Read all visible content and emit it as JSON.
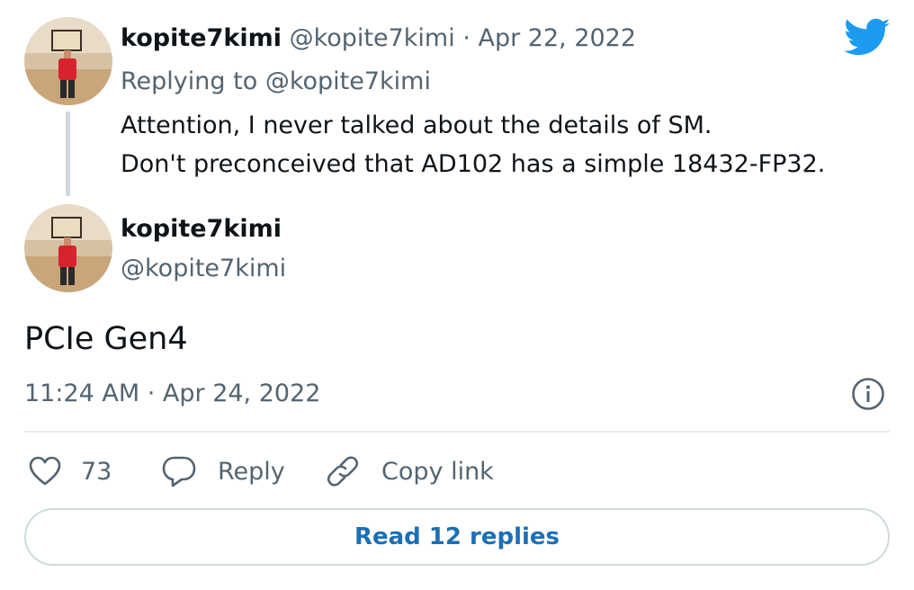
{
  "parent_tweet": {
    "display_name": "kopite7kimi",
    "handle": "@kopite7kimi",
    "separator": "·",
    "date": "Apr 22, 2022",
    "replying_prefix": "Replying to",
    "replying_handle": "@kopite7kimi",
    "text_lines": [
      "Attention, I never talked about the details of SM.",
      "Don't preconceived that AD102 has a simple 18432-FP32."
    ]
  },
  "tweet": {
    "display_name": "kopite7kimi",
    "handle": "@kopite7kimi",
    "text": "PCIe Gen4",
    "timestamp": "11:24 AM · Apr 24, 2022"
  },
  "actions": {
    "like_count": "73",
    "reply_label": "Reply",
    "copy_link_label": "Copy link"
  },
  "read_replies_label": "Read 12 replies",
  "icons": {
    "brand": "twitter-bird-icon",
    "info": "info-icon",
    "like": "heart-icon",
    "reply": "speech-bubble-icon",
    "copy": "link-icon"
  },
  "colors": {
    "brand_blue": "#1d9bf0",
    "link_blue": "#1d6fb5",
    "text": "#0f1419",
    "muted": "#536471",
    "border": "#cfd9de"
  }
}
